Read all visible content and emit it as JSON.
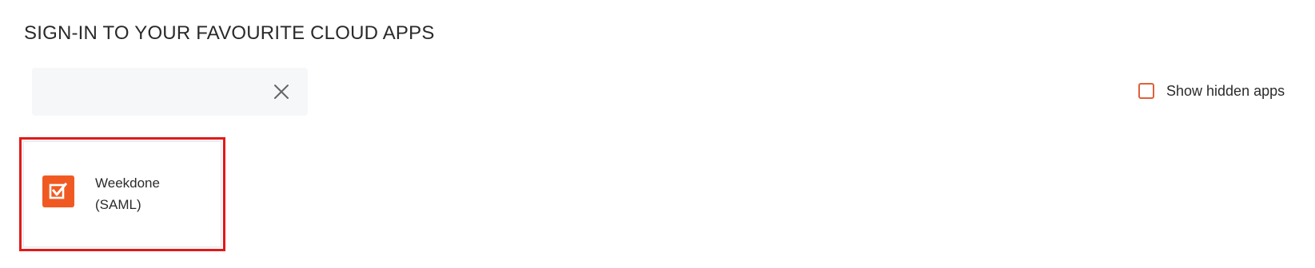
{
  "header": {
    "title": "SIGN-IN TO YOUR FAVOURITE CLOUD APPS"
  },
  "search": {
    "value": "",
    "placeholder": "",
    "clear_icon": "close-icon"
  },
  "filters": {
    "show_hidden_label": "Show hidden apps",
    "show_hidden_checked": false
  },
  "apps": [
    {
      "name_line1": "Weekdone",
      "name_line2": "(SAML)",
      "logo_icon": "checkbox-checked-icon",
      "logo_color": "#f05a22"
    }
  ],
  "colors": {
    "accent": "#e0603a",
    "highlight": "#e01a1a",
    "search_bg": "#f5f7f9"
  }
}
